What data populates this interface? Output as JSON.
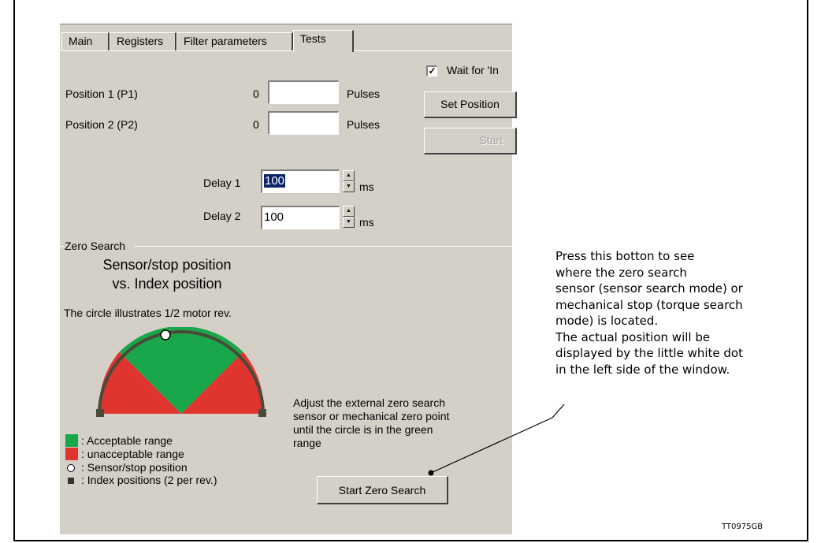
{
  "tabs": [
    {
      "label": "Main"
    },
    {
      "label": "Registers"
    },
    {
      "label": "Filter parameters"
    },
    {
      "label": "Tests"
    }
  ],
  "checkbox": {
    "label": "Wait for 'In",
    "checked": true
  },
  "position1": {
    "label": "Position 1 (P1)",
    "readout": "0",
    "value": "",
    "unit": "Pulses"
  },
  "position2": {
    "label": "Position 2 (P2)",
    "readout": "0",
    "value": "",
    "unit": "Pulses"
  },
  "buttons": {
    "set_position": "Set Position",
    "start": "Start",
    "start_zero_search": "Start Zero Search"
  },
  "delay1": {
    "label": "Delay 1",
    "value": "100",
    "unit": "ms"
  },
  "delay2": {
    "label": "Delay 2",
    "value": "100",
    "unit": "ms"
  },
  "zero_search": {
    "group_title": "Zero Search",
    "heading_line1": "Sensor/stop position",
    "heading_line2": "vs. Index position",
    "circle_note": "The circle illustrates 1/2 motor rev.",
    "adjust_text": [
      "Adjust the external zero search",
      "sensor or mechanical zero point",
      "until the circle is in the green",
      "range"
    ],
    "legend": [
      {
        "symbol": "green-square",
        "color": "#1aa64a",
        "label": ": Acceptable range"
      },
      {
        "symbol": "red-square",
        "color": "#e0342f",
        "label": ": unacceptable range"
      },
      {
        "symbol": "white-dot",
        "color": "#ffffff",
        "label": ": Sensor/stop position"
      },
      {
        "symbol": "dark-square",
        "color": "#333333",
        "label": ": Index positions (2 per rev.)"
      }
    ],
    "colors": {
      "acceptable": "#1aa64a",
      "unacceptable": "#e0342f",
      "index": "#4a4a3a"
    }
  },
  "annotation": {
    "lines": [
      "Press this botton to see",
      "where the zero search",
      "sensor (sensor search mode) or",
      "mechanical stop (torque search",
      "mode) is located.",
      "The actual position will be",
      "displayed by the little white dot",
      "in the left side of the window."
    ]
  },
  "figure_code": "TT0975GB"
}
